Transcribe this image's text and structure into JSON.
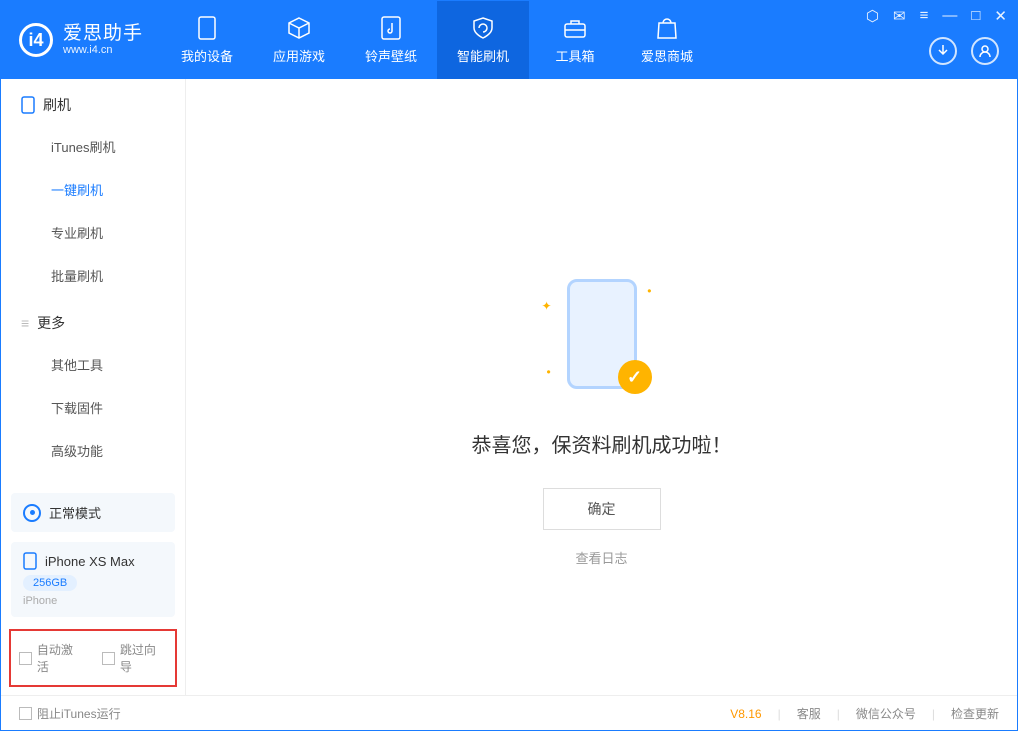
{
  "app": {
    "name_cn": "爱思助手",
    "name_en": "www.i4.cn"
  },
  "nav": {
    "items": [
      {
        "label": "我的设备"
      },
      {
        "label": "应用游戏"
      },
      {
        "label": "铃声壁纸"
      },
      {
        "label": "智能刷机"
      },
      {
        "label": "工具箱"
      },
      {
        "label": "爱思商城"
      }
    ]
  },
  "sidebar": {
    "section1": {
      "title": "刷机",
      "items": [
        "iTunes刷机",
        "一键刷机",
        "专业刷机",
        "批量刷机"
      ]
    },
    "section2": {
      "title": "更多",
      "items": [
        "其他工具",
        "下载固件",
        "高级功能"
      ]
    }
  },
  "mode_card": {
    "label": "正常模式"
  },
  "device_card": {
    "name": "iPhone XS Max",
    "capacity": "256GB",
    "type": "iPhone"
  },
  "options": {
    "auto_activate": "自动激活",
    "skip_guide": "跳过向导"
  },
  "main": {
    "success_title": "恭喜您，保资料刷机成功啦！",
    "ok_button": "确定",
    "view_log": "查看日志"
  },
  "footer": {
    "block_itunes": "阻止iTunes运行",
    "version": "V8.16",
    "support": "客服",
    "wechat": "微信公众号",
    "check_update": "检查更新"
  }
}
